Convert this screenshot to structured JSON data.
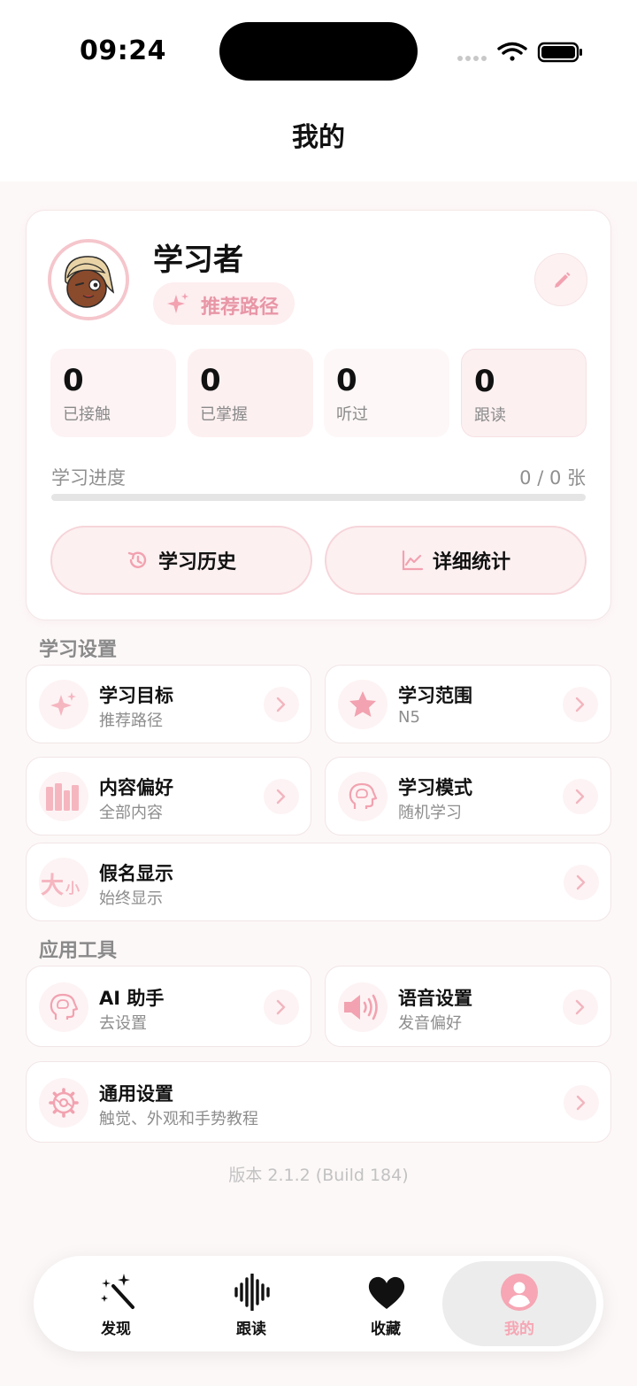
{
  "status_bar": {
    "time": "09:24"
  },
  "header": {
    "title": "我的"
  },
  "profile": {
    "username": "学习者",
    "path_badge": "推荐路径",
    "stats": [
      {
        "value": "0",
        "label": "已接触"
      },
      {
        "value": "0",
        "label": "已掌握"
      },
      {
        "value": "0",
        "label": "听过"
      },
      {
        "value": "0",
        "label": "跟读"
      }
    ],
    "progress": {
      "label": "学习进度",
      "count": "0 / 0 张",
      "fraction": 0
    },
    "history_button": "学习历史",
    "stats_button": "详细统计"
  },
  "learning_settings": {
    "title": "学习设置",
    "items": [
      {
        "title": "学习目标",
        "subtitle": "推荐路径",
        "icon": "sparkle-icon"
      },
      {
        "title": "学习范围",
        "subtitle": "N5",
        "icon": "star-icon"
      },
      {
        "title": "内容偏好",
        "subtitle": "全部内容",
        "icon": "books-icon"
      },
      {
        "title": "学习模式",
        "subtitle": "随机学习",
        "icon": "brain-head-icon"
      },
      {
        "title": "假名显示",
        "subtitle": "始终显示",
        "icon": "size-text-icon",
        "glyph_big": "大",
        "glyph_small": "小"
      }
    ]
  },
  "app_tools": {
    "title": "应用工具",
    "items": [
      {
        "title": "AI 助手",
        "subtitle": "去设置",
        "icon": "brain-head-icon"
      },
      {
        "title": "语音设置",
        "subtitle": "发音偏好",
        "icon": "speaker-icon"
      },
      {
        "title": "通用设置",
        "subtitle": "触觉、外观和手势教程",
        "icon": "gear-icon"
      }
    ]
  },
  "version": "版本 2.1.2 (Build 184)",
  "tabbar": {
    "items": [
      {
        "label": "发现",
        "icon": "magic-wand-icon"
      },
      {
        "label": "跟读",
        "icon": "waveform-icon"
      },
      {
        "label": "收藏",
        "icon": "heart-icon"
      },
      {
        "label": "我的",
        "icon": "person-icon",
        "active": true
      }
    ]
  },
  "colors": {
    "accent": "#f2a2b0",
    "accent_text": "#e896a6",
    "background": "#fdf8f8"
  }
}
